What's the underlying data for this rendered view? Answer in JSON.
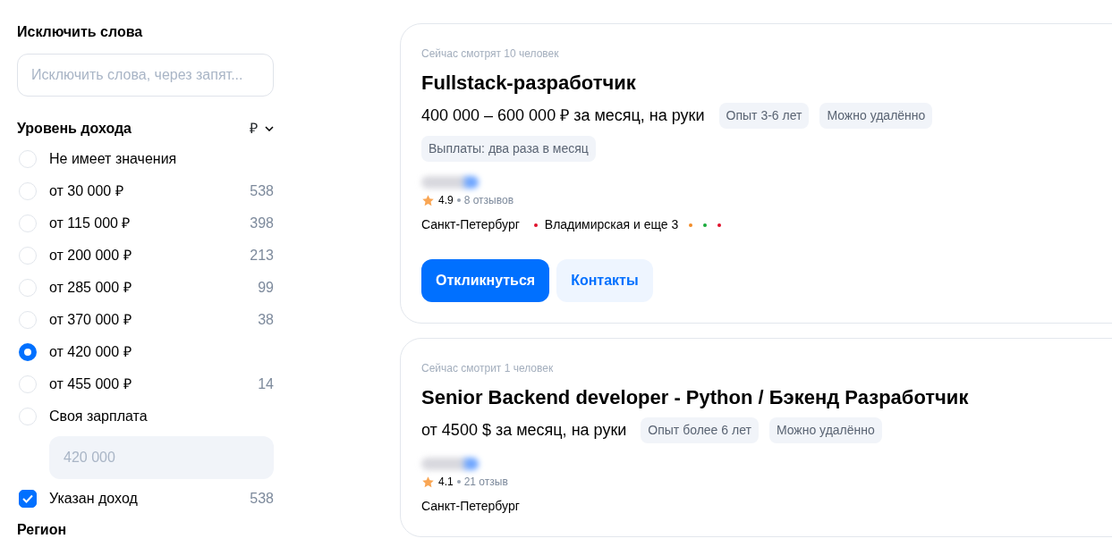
{
  "filters": {
    "exclude_words": {
      "title": "Исключить слова",
      "placeholder": "Исключить слова, через запят..."
    },
    "income": {
      "title": "Уровень дохода",
      "currency": "₽",
      "options": [
        {
          "kind": "radio",
          "label": "Не имеет значения",
          "selected": false
        },
        {
          "kind": "radio",
          "label": "от 30 000 ₽",
          "count": "538",
          "selected": false
        },
        {
          "kind": "radio",
          "label": "от 115 000 ₽",
          "count": "398",
          "selected": false
        },
        {
          "kind": "radio",
          "label": "от 200 000 ₽",
          "count": "213",
          "selected": false
        },
        {
          "kind": "radio",
          "label": "от 285 000 ₽",
          "count": "99",
          "selected": false
        },
        {
          "kind": "radio",
          "label": "от 370 000 ₽",
          "count": "38",
          "selected": false
        },
        {
          "kind": "radio",
          "label": "от 420 000 ₽",
          "selected": true
        },
        {
          "kind": "radio",
          "label": "от 455 000 ₽",
          "count": "14",
          "selected": false
        },
        {
          "kind": "radio",
          "label": "Своя зарплата",
          "selected": false
        },
        {
          "kind": "field",
          "placeholder": "420 000"
        },
        {
          "kind": "checkbox",
          "label": "Указан доход",
          "count": "538",
          "checked": true
        }
      ]
    },
    "region": {
      "title": "Регион"
    }
  },
  "vacancies": [
    {
      "viewers": "Сейчас смотрят 10 человек",
      "title": "Fullstack-разработчик",
      "salary": "400 000 – 600 000 ₽ за месяц, на руки",
      "tags": [
        "Опыт 3-6 лет",
        "Можно удалённо"
      ],
      "payment_tag": "Выплаты: два раза в месяц",
      "rating": "4.9",
      "reviews": "8 отзывов",
      "city": "Санкт-Петербург",
      "metro": {
        "name": "Владимирская и еще 3",
        "color": "#e0112b",
        "more_lines": [
          {
            "color": "#f28c28"
          },
          {
            "color": "#1aaa3c"
          },
          {
            "color": "#e0112b"
          }
        ]
      },
      "buttons": [
        {
          "kind": "primary",
          "label": "Откликнуться"
        },
        {
          "kind": "secondary",
          "label": "Контакты"
        }
      ]
    },
    {
      "viewers": "Сейчас смотрит 1 человек",
      "title": "Senior Backend developer - Python / Бэкенд Разработчик",
      "salary": "от 4500 $ за месяц, на руки",
      "tags": [
        "Опыт более 6 лет",
        "Можно удалённо"
      ],
      "rating": "4.1",
      "reviews": "21 отзыв",
      "city": "Санкт-Петербург"
    }
  ]
}
